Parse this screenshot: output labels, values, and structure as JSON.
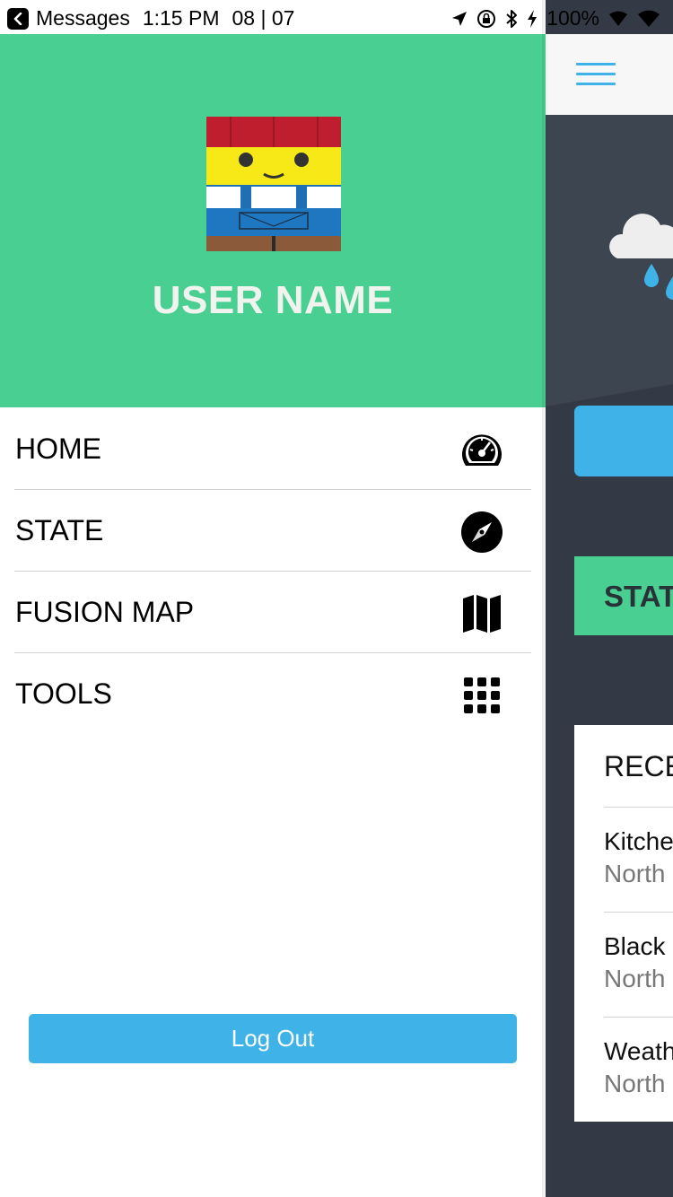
{
  "status_bar": {
    "back_app": "Messages",
    "time": "1:15 PM",
    "date": "08 | 07",
    "battery": "100%"
  },
  "drawer": {
    "user_name": "USER NAME",
    "menu": [
      {
        "label": "HOME",
        "icon": "speedometer-icon"
      },
      {
        "label": "STATE",
        "icon": "compass-icon"
      },
      {
        "label": "FUSION MAP",
        "icon": "map-icon"
      },
      {
        "label": "TOOLS",
        "icon": "grid-icon"
      }
    ],
    "logout_label": "Log Out"
  },
  "main": {
    "state_heading": "STAT",
    "card_title": "RECE",
    "rows": [
      {
        "title": "Kitche",
        "subtitle": "North"
      },
      {
        "title": "Black",
        "subtitle": "North"
      },
      {
        "title": "Weath",
        "subtitle": "North"
      }
    ]
  },
  "colors": {
    "accent_green": "#48cf91",
    "accent_blue": "#3fb3e8",
    "dark_bg": "#343a45"
  }
}
